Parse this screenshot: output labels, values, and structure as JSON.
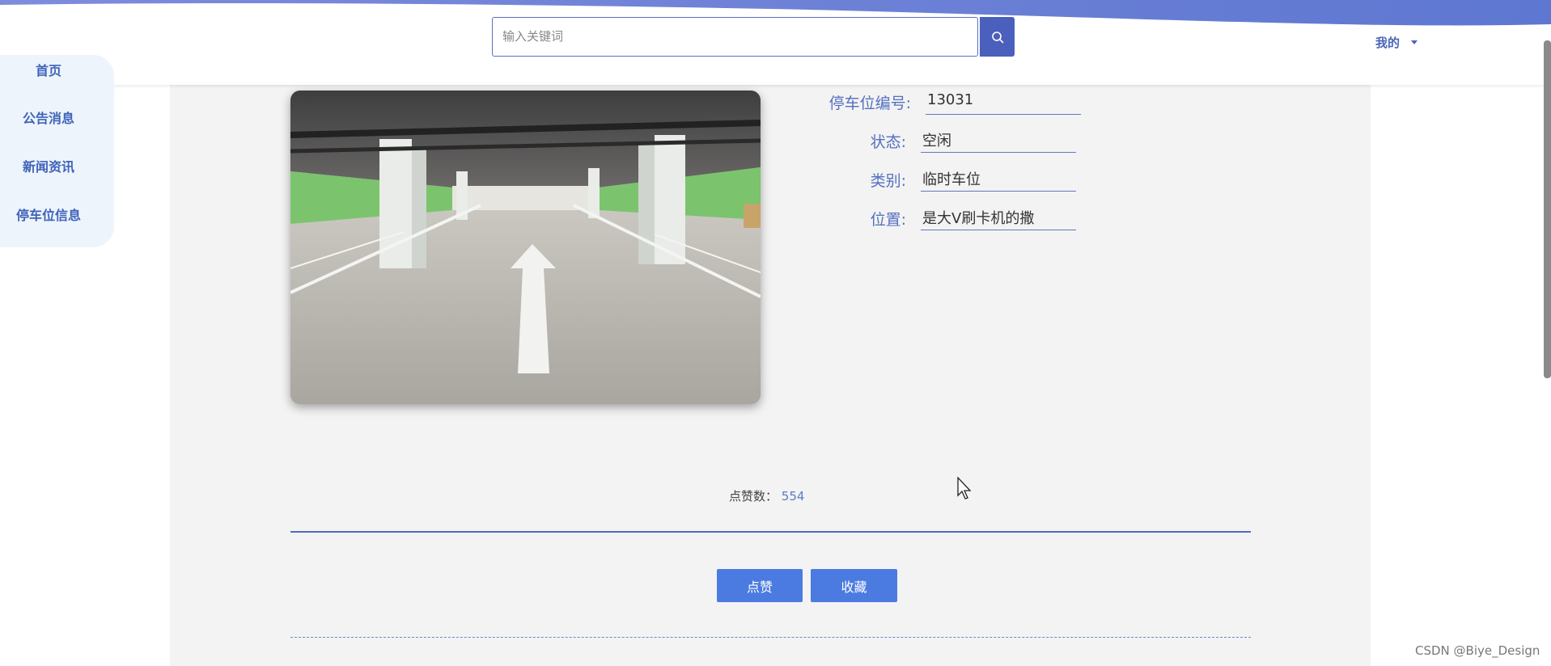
{
  "header": {
    "search_placeholder": "输入关键词",
    "user_menu_label": "我的"
  },
  "sidebar": {
    "items": [
      {
        "label": "首页"
      },
      {
        "label": "公告消息"
      },
      {
        "label": "新闻资讯"
      },
      {
        "label": "停车位信息"
      }
    ]
  },
  "detail": {
    "fields": [
      {
        "label": "停车位编号:",
        "value": "13031"
      },
      {
        "label": "状态:",
        "value": "空闲"
      },
      {
        "label": "类别:",
        "value": "临时车位"
      },
      {
        "label": "位置:",
        "value": "是大V刷卡机的撒"
      }
    ],
    "likes_label": "点赞数：",
    "likes_count": "554",
    "like_button": "点赞",
    "favorite_button": "收藏"
  },
  "watermark": "CSDN @Biye_Design",
  "colors": {
    "accent": "#4b5fbd",
    "nav_text": "#3f63b8",
    "button": "#4b7be0",
    "page_bg": "#f3f3f3"
  }
}
